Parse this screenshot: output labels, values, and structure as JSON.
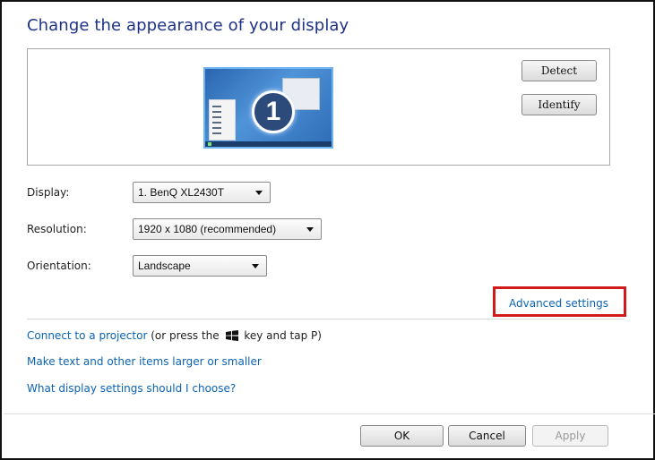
{
  "page": {
    "title": "Change the appearance of your display"
  },
  "preview": {
    "monitor_number": "1",
    "detect_label": "Detect",
    "identify_label": "Identify"
  },
  "settings": {
    "display_label": "Display:",
    "display_value": "1. BenQ XL2430T",
    "resolution_label": "Resolution:",
    "resolution_value": "1920 x 1080 (recommended)",
    "orientation_label": "Orientation:",
    "orientation_value": "Landscape"
  },
  "links": {
    "advanced_settings": "Advanced settings",
    "connect_projector": "Connect to a projector",
    "connect_projector_suffix_a": "(or press the",
    "connect_projector_suffix_b": "key and tap P)",
    "text_size": "Make text and other items larger or smaller",
    "which_settings": "What display settings should I choose?"
  },
  "footer": {
    "ok_label": "OK",
    "cancel_label": "Cancel",
    "apply_label": "Apply"
  },
  "colors": {
    "title": "#1e3287",
    "link": "#0a63b3",
    "highlight": "#d11a1a"
  }
}
